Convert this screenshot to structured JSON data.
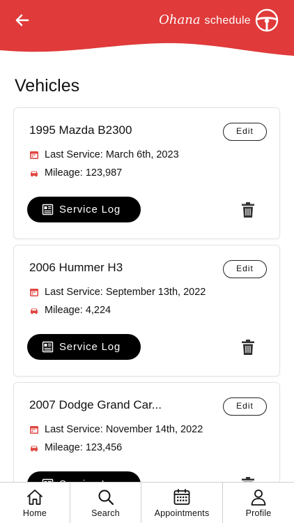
{
  "header": {
    "brand_script": "Ohana",
    "brand_word": "schedule",
    "back_icon": "arrow-left-icon",
    "logo_icon": "steering-wheel-icon",
    "color": "#e03a3a"
  },
  "page": {
    "title": "Vehicles"
  },
  "vehicles": [
    {
      "name": "1995 Mazda B2300",
      "last_service": "Last Service: March 6th, 2023",
      "mileage": "Mileage: 123,987",
      "edit_label": "Edit",
      "log_label": "Service Log"
    },
    {
      "name": "2006 Hummer H3",
      "last_service": "Last Service: September 13th, 2022",
      "mileage": "Mileage: 4,224",
      "edit_label": "Edit",
      "log_label": "Service Log"
    },
    {
      "name": "2007 Dodge Grand Car...",
      "last_service": "Last Service: November 14th, 2022",
      "mileage": "Mileage: 123,456",
      "edit_label": "Edit",
      "log_label": "Service Log"
    }
  ],
  "tabs": [
    {
      "label": "Home",
      "icon": "home-icon"
    },
    {
      "label": "Search",
      "icon": "search-icon"
    },
    {
      "label": "Appointments",
      "icon": "calendar-icon"
    },
    {
      "label": "Profile",
      "icon": "user-icon"
    }
  ],
  "colors": {
    "accent": "#e03a3a",
    "icon_red": "#e0463f",
    "button": "#000000"
  }
}
